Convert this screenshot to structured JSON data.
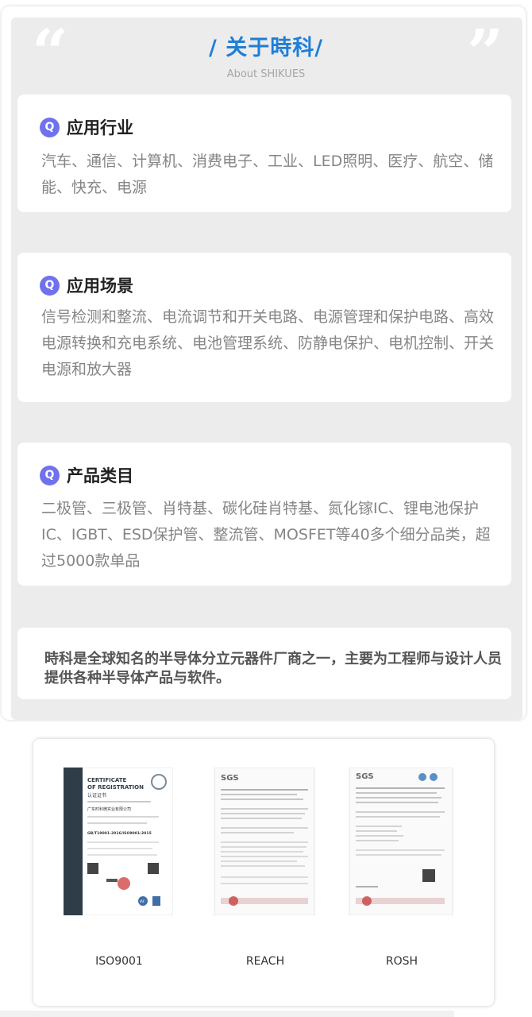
{
  "header": {
    "title": "/ 关于時科/",
    "subtitle": "About SHIKUES",
    "quote_left": "“",
    "quote_right": "”"
  },
  "cards": [
    {
      "icon": "Q",
      "title": "应用行业",
      "text": "汽车、通信、计算机、消费电子、工业、LED照明、医疗、航空、储能、快充、电源"
    },
    {
      "icon": "Q",
      "title": "应用场景",
      "text": "信号检测和整流、电流调节和开关电路、电源管理和保护电路、高效电源转换和充电系统、电池管理系统、防静电保护、电机控制、开关电源和放大器"
    },
    {
      "icon": "Q",
      "title": "产品类目",
      "text": "二极管、三极管、肖特基、碳化硅肖特基、氮化镓IC、锂电池保护IC、IGBT、ESD保护管、整流管、MOSFET等40多个细分品类，超过5000款单品"
    }
  ],
  "description": "時科是全球知名的半导体分立元器件厂商之一，主要为工程师与设计人员提供各种半导体产品与软件。",
  "certificates": [
    {
      "label": "ISO9001",
      "doc": {
        "heading1": "CERTIFICATE",
        "heading2": "OF REGISTRATION",
        "sub": "认证证书",
        "company": "广东时科微实业有限公司",
        "standard": "GB/T19001-2016/ISO9001:2015",
        "badge": "IAF"
      }
    },
    {
      "label": "REACH",
      "doc": {
        "logo": "SGS"
      }
    },
    {
      "label": "ROSH",
      "doc": {
        "logo": "SGS"
      }
    }
  ],
  "colors": {
    "accent": "#1f7ed8",
    "icon": "#6f72ec",
    "panel": "#ececec"
  }
}
